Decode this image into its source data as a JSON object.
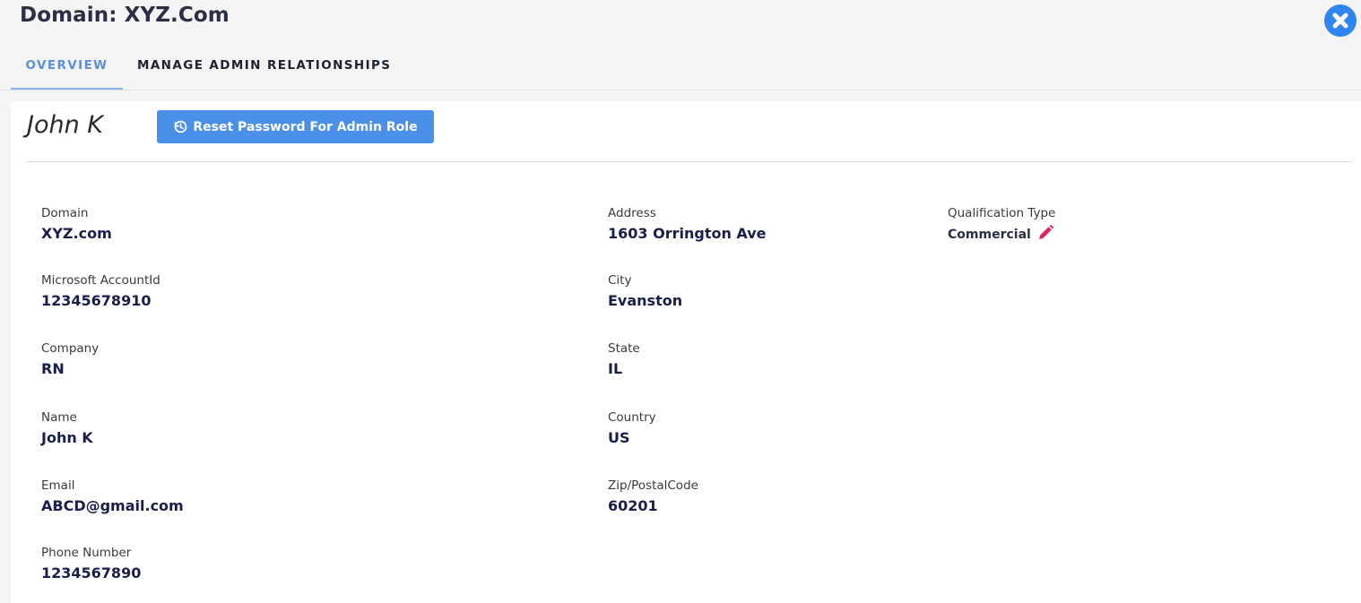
{
  "header": {
    "title": "Domain: XYZ.Com",
    "close_icon": "close-circle-icon",
    "accent_color": "#2f86f0"
  },
  "tabs": [
    {
      "label": "OVERVIEW",
      "active": true
    },
    {
      "label": "MANAGE ADMIN RELATIONSHIPS",
      "active": false
    }
  ],
  "card": {
    "user_name": "John K",
    "reset_button": {
      "label": "Reset Password For Admin Role",
      "icon": "reset-history-icon",
      "color": "#4a90e8"
    }
  },
  "fields": {
    "domain": {
      "label": "Domain",
      "value": "XYZ.com"
    },
    "microsoft_account_id": {
      "label": "Microsoft AccountId",
      "value": "12345678910"
    },
    "company": {
      "label": "Company",
      "value": "RN"
    },
    "name": {
      "label": "Name",
      "value": "John K"
    },
    "email": {
      "label": "Email",
      "value": "ABCD@gmail.com"
    },
    "phone": {
      "label": "Phone Number",
      "value": "1234567890"
    },
    "address": {
      "label": "Address",
      "value": "1603 Orrington Ave"
    },
    "city": {
      "label": "City",
      "value": "Evanston"
    },
    "state": {
      "label": "State",
      "value": "IL"
    },
    "country": {
      "label": "Country",
      "value": "US"
    },
    "zip": {
      "label": "Zip/PostalCode",
      "value": "60201"
    },
    "qualification_type": {
      "label": "Qualification Type",
      "value": "Commercial",
      "edit_icon": "pencil-icon",
      "edit_color": "#e0245e"
    }
  }
}
